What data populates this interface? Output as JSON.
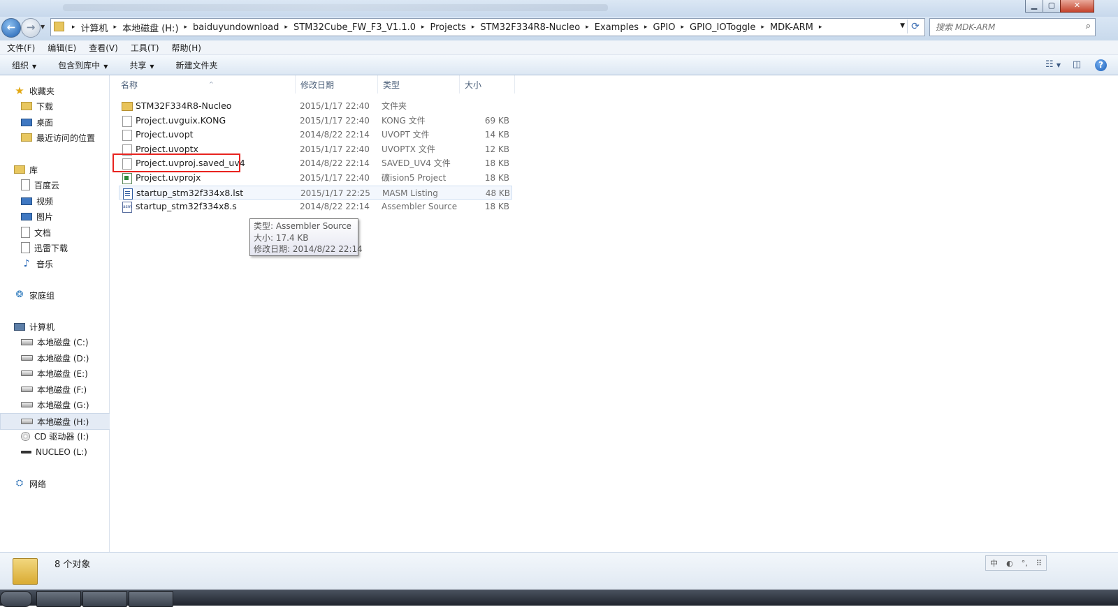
{
  "window": {
    "minimize_label": "▁",
    "maximize_label": "▢",
    "close_label": "✕"
  },
  "address": {
    "breadcrumbs": [
      "计算机",
      "本地磁盘 (H:)",
      "baiduyundownload",
      "STM32Cube_FW_F3_V1.1.0",
      "Projects",
      "STM32F334R8-Nucleo",
      "Examples",
      "GPIO",
      "GPIO_IOToggle",
      "MDK-ARM"
    ],
    "separator": "▸",
    "search_placeholder": "搜索 MDK-ARM"
  },
  "menu": [
    "文件(F)",
    "编辑(E)",
    "查看(V)",
    "工具(T)",
    "帮助(H)"
  ],
  "toolbar": {
    "organize": "组织",
    "include_in_library": "包含到库中",
    "share": "共享",
    "new_folder": "新建文件夹"
  },
  "nav": {
    "favorites": "收藏夹",
    "downloads": "下载",
    "desktop": "桌面",
    "recent": "最近访问的位置",
    "libraries": "库",
    "baidu_cloud": "百度云",
    "videos": "视频",
    "pictures": "图片",
    "documents": "文档",
    "xunlei": "迅雷下载",
    "music": "音乐",
    "homegroup": "家庭组",
    "computer": "计算机",
    "drive_c": "本地磁盘 (C:)",
    "drive_d": "本地磁盘 (D:)",
    "drive_e": "本地磁盘 (E:)",
    "drive_f": "本地磁盘 (F:)",
    "drive_g": "本地磁盘 (G:)",
    "drive_h": "本地磁盘 (H:)",
    "drive_i": "CD 驱动器 (I:)",
    "drive_l": "NUCLEO (L:)",
    "network": "网络"
  },
  "columns": {
    "name": "名称",
    "date": "修改日期",
    "type": "类型",
    "size": "大小"
  },
  "files": [
    {
      "name": "STM32F334R8-Nucleo",
      "date": "2015/1/17 22:40",
      "type": "文件夹",
      "size": "",
      "icon": "folder-icon"
    },
    {
      "name": "Project.uvguix.KONG",
      "date": "2015/1/17 22:40",
      "type": "KONG 文件",
      "size": "69 KB",
      "icon": "file-icon"
    },
    {
      "name": "Project.uvopt",
      "date": "2014/8/22 22:14",
      "type": "UVOPT 文件",
      "size": "14 KB",
      "icon": "file-icon"
    },
    {
      "name": "Project.uvoptx",
      "date": "2015/1/17 22:40",
      "type": "UVOPTX 文件",
      "size": "12 KB",
      "icon": "file-icon"
    },
    {
      "name": "Project.uvproj.saved_uv4",
      "date": "2014/8/22 22:14",
      "type": "SAVED_UV4 文件",
      "size": "18 KB",
      "icon": "file-icon"
    },
    {
      "name": "Project.uvprojx",
      "date": "2015/1/17 22:40",
      "type": "礦ision5 Project",
      "size": "18 KB",
      "icon": "project-icon"
    },
    {
      "name": "startup_stm32f334x8.lst",
      "date": "2015/1/17 22:25",
      "type": "MASM Listing",
      "size": "48 KB",
      "icon": "listing-icon"
    },
    {
      "name": "startup_stm32f334x8.s",
      "date": "2014/8/22 22:14",
      "type": "Assembler Source",
      "size": "18 KB",
      "icon": "asm-icon"
    }
  ],
  "tooltip": {
    "type": "类型: Assembler Source",
    "size": "大小: 17.4 KB",
    "date": "修改日期: 2014/8/22 22:14"
  },
  "status": {
    "count": "8 个对象"
  },
  "ime": [
    "中",
    "◐",
    "°,",
    "⠿"
  ],
  "colors": {
    "highlight_box": "#e8231f",
    "selected_nav": "#e4ebf5"
  }
}
